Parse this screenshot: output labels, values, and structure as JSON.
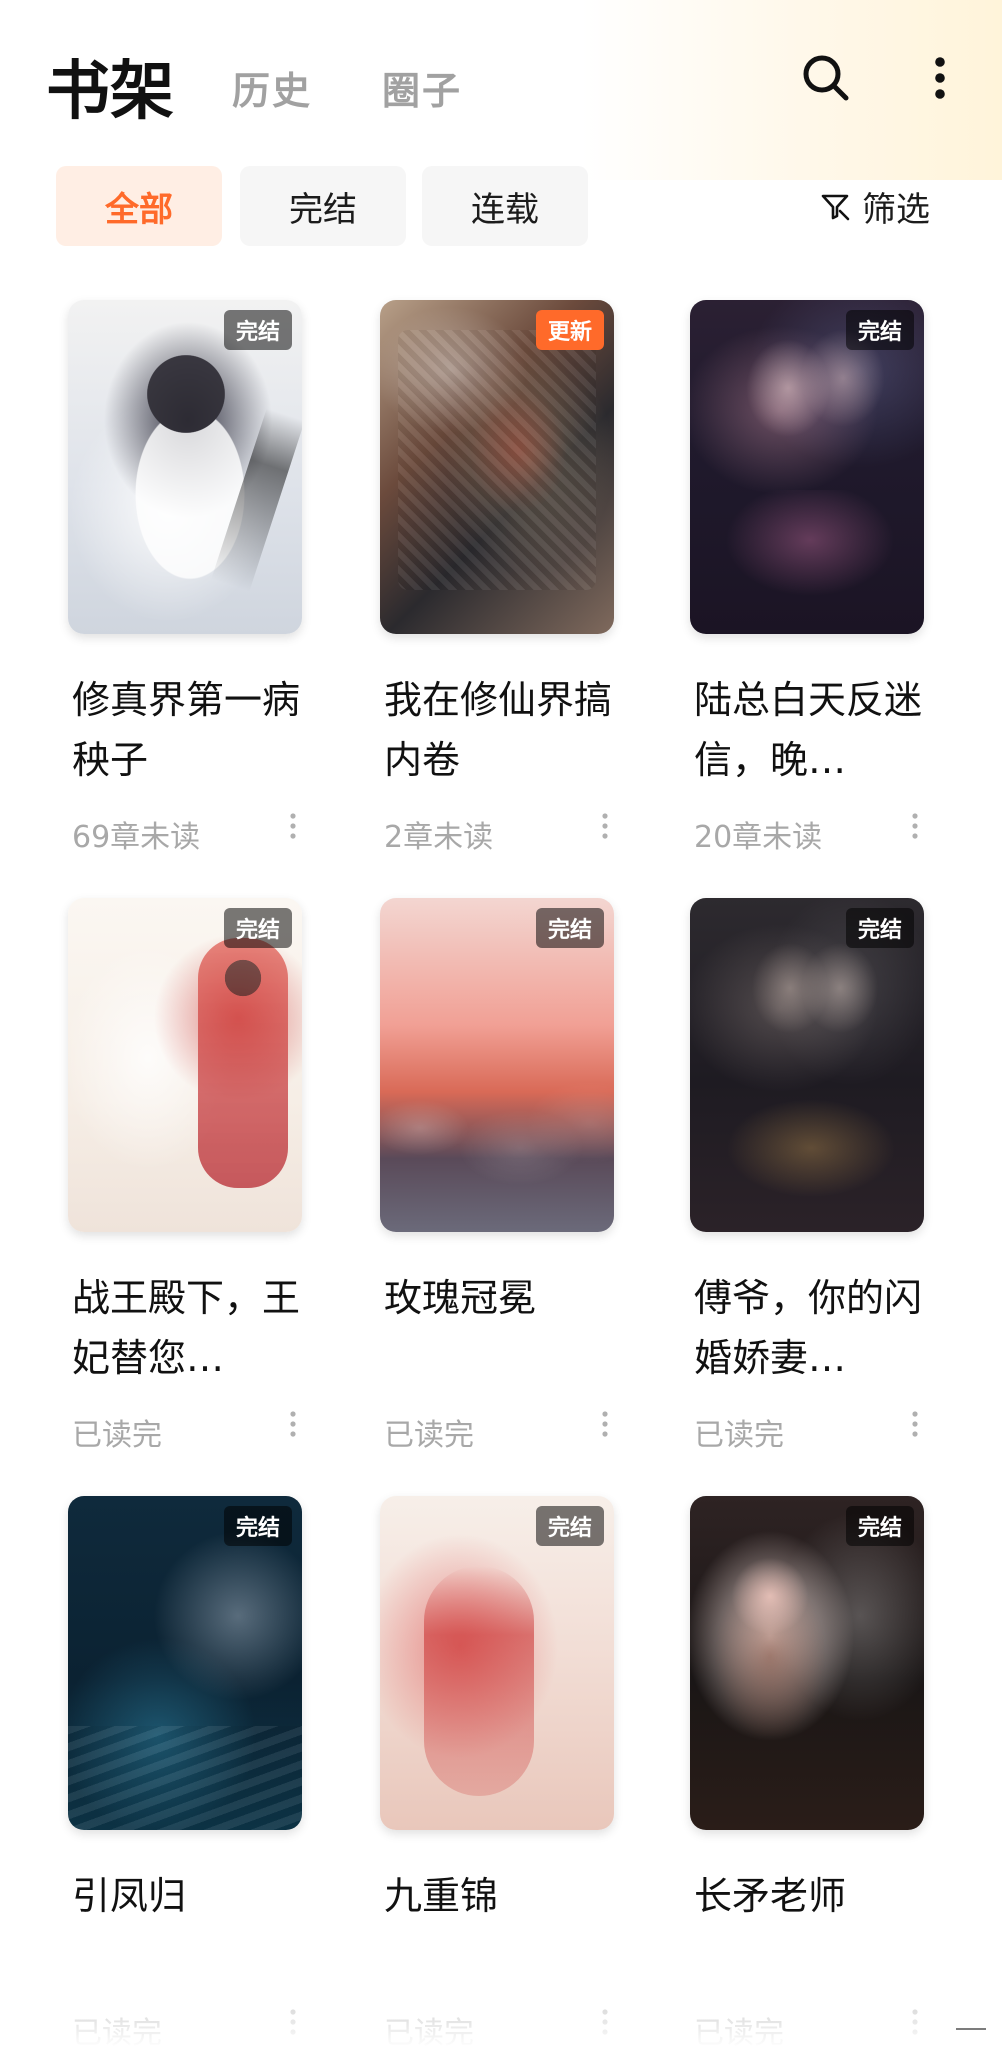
{
  "header": {
    "tabs": [
      {
        "label": "书架"
      },
      {
        "label": "历史"
      },
      {
        "label": "圈子"
      }
    ],
    "icons": {
      "search": "search-icon",
      "more": "more-vertical-icon"
    }
  },
  "filters": {
    "chips": [
      {
        "label": "全部"
      },
      {
        "label": "完结"
      },
      {
        "label": "连载"
      }
    ],
    "filter_label": "筛选",
    "filter_icon": "filter-icon"
  },
  "books": [
    {
      "badge": "完结",
      "title": "修真界第一病秧子",
      "meta": "69章未读"
    },
    {
      "badge": "更新",
      "title": "我在修仙界搞内卷",
      "meta": "2章未读"
    },
    {
      "badge": "完结",
      "title": "陆总白天反迷信，晚…",
      "meta": "20章未读"
    },
    {
      "badge": "完结",
      "title": "战王殿下，王妃替您…",
      "meta": "已读完"
    },
    {
      "badge": "完结",
      "title": "玫瑰冠冕",
      "meta": "已读完"
    },
    {
      "badge": "完结",
      "title": "傅爷，你的闪婚娇妻…",
      "meta": "已读完"
    },
    {
      "badge": "完结",
      "title": "引凤归",
      "meta": "已读完"
    },
    {
      "badge": "完结",
      "title": "九重锦",
      "meta": "已读完"
    },
    {
      "badge": "完结",
      "title": "长矛老师",
      "meta": "已读完"
    }
  ],
  "colors": {
    "accent": "#ff6a2a",
    "chip_active_bg": "#ffeee4",
    "chip_bg": "#f6f6f6",
    "muted_text": "#a8a8a8"
  }
}
